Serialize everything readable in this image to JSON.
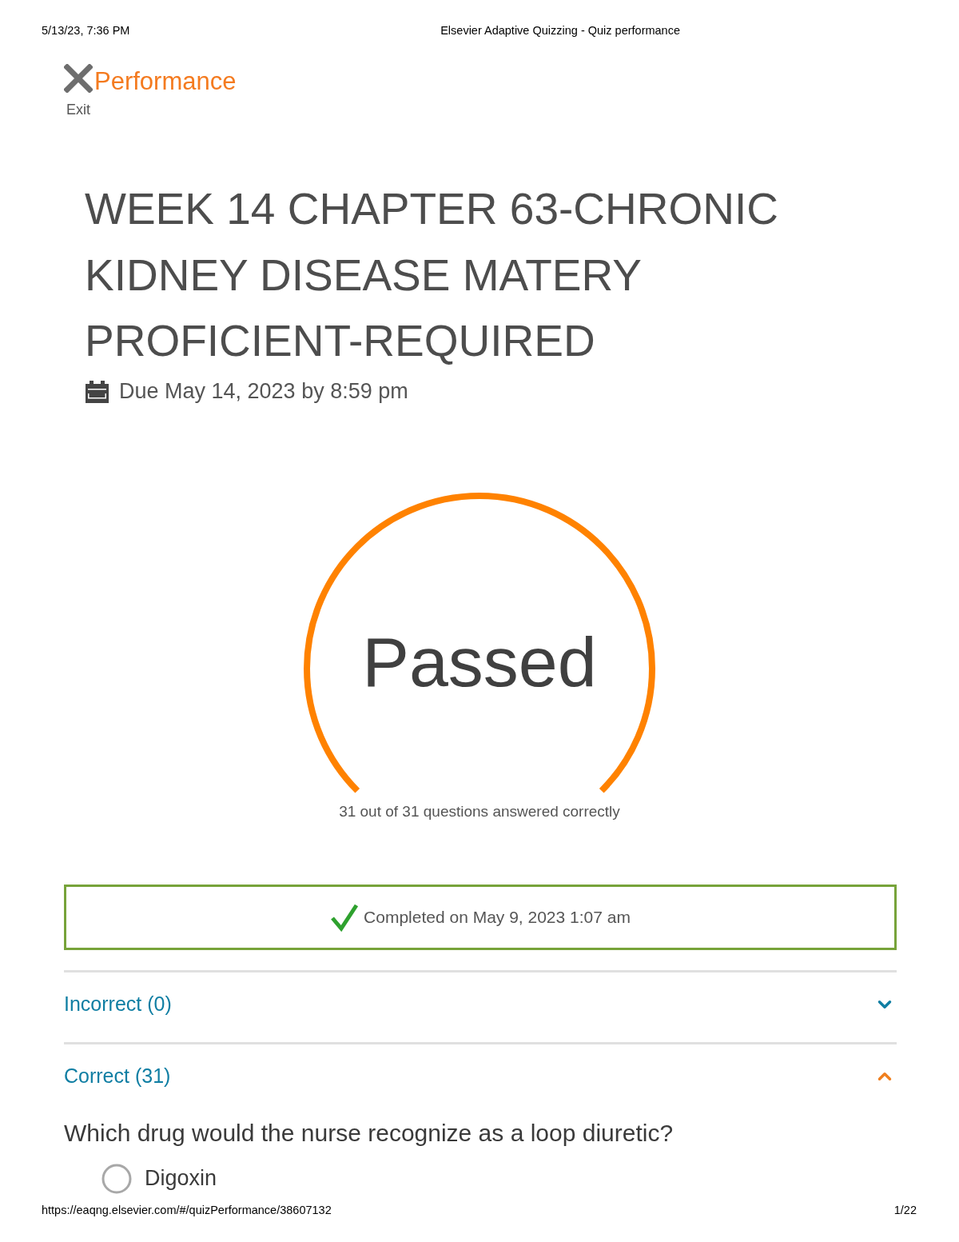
{
  "print_header": {
    "date": "5/13/23, 7:36 PM",
    "title": "Elsevier Adaptive Quizzing - Quiz performance"
  },
  "nav": {
    "exit_label": "Exit",
    "heading": "Performance"
  },
  "quiz": {
    "title": "WEEK 14 CHAPTER 63-CHRONIC KIDNEY DISEASE MATERY PROFICIENT-REQUIRED",
    "due": "Due May 14, 2023 by 8:59 pm"
  },
  "result": {
    "status": "Passed",
    "level": 1,
    "summary": "31 out of 31 questions answered correctly"
  },
  "completion": {
    "text": "Completed on May 9, 2023 1:07 am"
  },
  "sections": [
    {
      "label": "Incorrect (0)",
      "expanded": false
    },
    {
      "label": "Correct (31)",
      "expanded": true,
      "questions": [
        {
          "text": "Which drug would the nurse recognize as a loop diuretic?",
          "options": [
            {
              "label": "Digoxin",
              "selected": false
            }
          ]
        }
      ]
    }
  ],
  "print_footer": {
    "url": "https://eaqng.elsevier.com/#/quizPerformance/38607132",
    "page": "1/22"
  }
}
